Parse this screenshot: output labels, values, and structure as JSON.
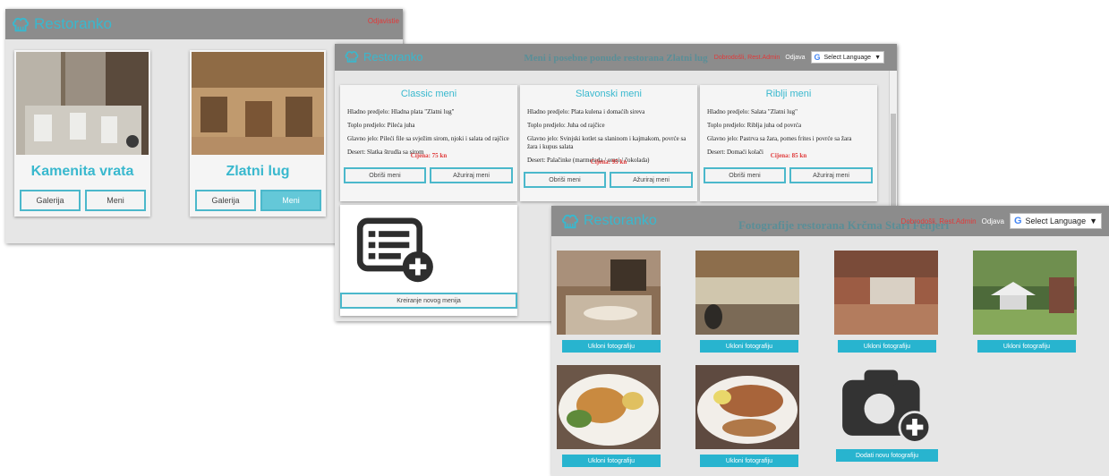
{
  "brand": "Restoranko",
  "w1": {
    "header_right": "Odjavistie",
    "restaurants": [
      {
        "name": "Kamenita vrata",
        "buttons": [
          "Galerija",
          "Meni"
        ]
      },
      {
        "name": "Zlatni lug",
        "buttons": [
          "Galerija",
          "Meni"
        ]
      }
    ]
  },
  "w2": {
    "title": "Meni i posebne ponude restorana Zlatni lug",
    "welcome": "Dobrodošli, Rest.Admin",
    "logout": "Odjava",
    "language": "Select Language",
    "menus": [
      {
        "title": "Classic meni",
        "lines": [
          "Hladno predjelo: Hladna plata \"Zlatni lug\"",
          "Toplo predjelo: Pileća juha",
          "Glavno jelo: Pileći file sa svježim sirom, njoki i salata od rajčice",
          "Desert: Slatka štrudla sa sirom"
        ],
        "price": "Cijena: 75 kn",
        "buttons": [
          "Obriši meni",
          "Ažuriraj meni"
        ]
      },
      {
        "title": "Slavonski meni",
        "lines": [
          "Hladno predjelo: Plata kulena i domaćih sireva",
          "Toplo predjelo: Juha od rajčice",
          "Glavno jelo: Svinjski kotlet sa slaninom i kajmakom, povrće sa žara i kupus salata",
          "Desert: Palačinke (marmelada / orasi / čokolada)"
        ],
        "price": "Cijena: 95 kn",
        "buttons": [
          "Obriši meni",
          "Ažuriraj meni"
        ]
      },
      {
        "title": "Riblji meni",
        "lines": [
          "Hladno predjelo: Salata \"Zlatni lug\"",
          "Toplo predjelo: Riblja juha od povrća",
          "Glavno jelo: Pastrva sa žara, pomes frites i povrće sa žara",
          "Desert: Domaći kolači"
        ],
        "price": "Cijena: 85 kn",
        "buttons": [
          "Obriši meni",
          "Ažuriraj meni"
        ]
      }
    ],
    "create_button": "Kreiranje novog menija"
  },
  "w3": {
    "title": "Fotografije restorana Krčma Stari Fenjeri",
    "welcome": "Dobrodošli, Rest.Admin",
    "logout": "Odjava",
    "language": "Select Language",
    "remove_label": "Ukloni fotografiju",
    "add_label": "Dodati novu fotografiju"
  }
}
